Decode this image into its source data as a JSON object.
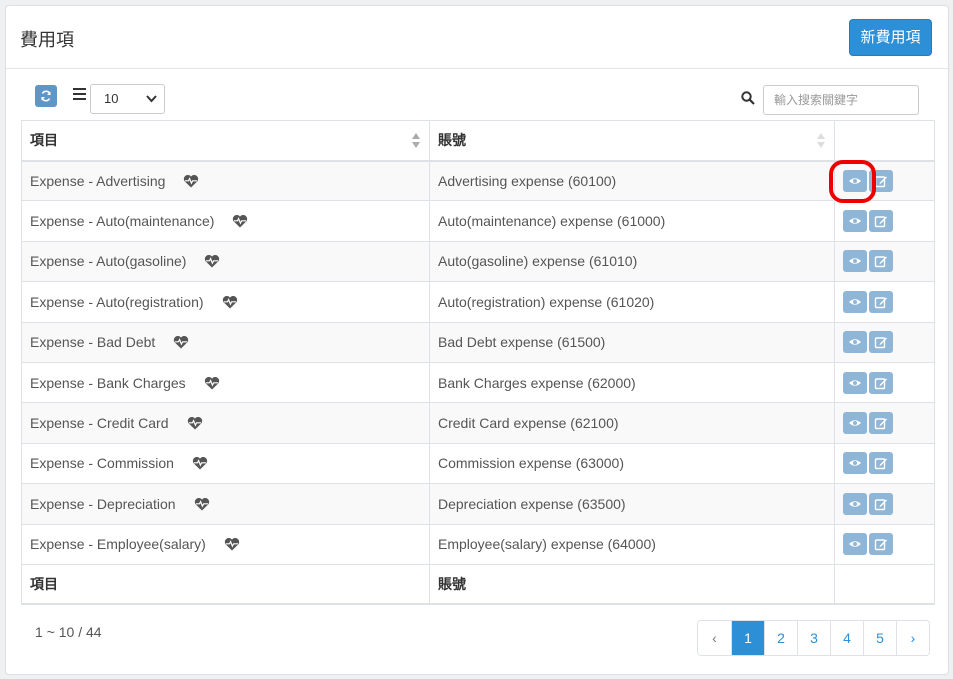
{
  "header": {
    "title": "費用項",
    "new_button": "新費用項"
  },
  "toolbar": {
    "page_size": "10",
    "search_placeholder": "輸入搜索關鍵字"
  },
  "table": {
    "columns": [
      "項目",
      "賬號",
      ""
    ],
    "rows": [
      {
        "item": "Expense - Advertising",
        "account": "Advertising expense (60100)"
      },
      {
        "item": "Expense - Auto(maintenance)",
        "account": "Auto(maintenance) expense (61000)"
      },
      {
        "item": "Expense - Auto(gasoline)",
        "account": "Auto(gasoline) expense (61010)"
      },
      {
        "item": "Expense - Auto(registration)",
        "account": "Auto(registration) expense (61020)"
      },
      {
        "item": "Expense - Bad Debt",
        "account": "Bad Debt expense (61500)"
      },
      {
        "item": "Expense - Bank Charges",
        "account": "Bank Charges expense (62000)"
      },
      {
        "item": "Expense - Credit Card",
        "account": "Credit Card expense (62100)"
      },
      {
        "item": "Expense - Commission",
        "account": "Commission expense (63000)"
      },
      {
        "item": "Expense - Depreciation",
        "account": "Depreciation expense (63500)"
      },
      {
        "item": "Expense - Employee(salary)",
        "account": "Employee(salary) expense (64000)"
      }
    ],
    "footer": [
      "項目",
      "賬號",
      ""
    ]
  },
  "summary": "1 ~ 10 / 44",
  "pagination": {
    "prev": "‹",
    "pages": [
      "1",
      "2",
      "3",
      "4",
      "5"
    ],
    "next": "›",
    "active": "1"
  },
  "icons": {
    "refresh": "refresh-icon",
    "list": "list-icon",
    "search": "search-icon",
    "heart": "heartbeat-icon",
    "view": "eye-icon",
    "edit": "edit-icon"
  },
  "colors": {
    "primary": "#2d8fd5",
    "action_button": "#8fb6d7",
    "highlight": "#ee0000"
  }
}
